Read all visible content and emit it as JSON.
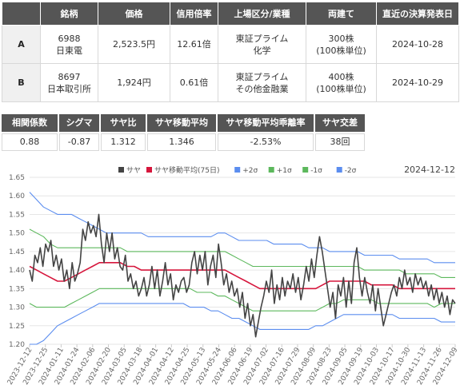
{
  "table": {
    "headers": [
      "",
      "銘柄",
      "価格",
      "信用倍率",
      "上場区分/業種",
      "両建て",
      "直近の決算発表日"
    ],
    "rows": [
      {
        "label": "A",
        "code": "6988",
        "name": "日東電",
        "price": "2,523.5円",
        "ratio": "12.61倍",
        "market": "東証プライム",
        "sector": "化学",
        "shares": "300株",
        "unit": "(100株単位)",
        "date": "2024-10-28"
      },
      {
        "label": "B",
        "code": "8697",
        "name": "日本取引所",
        "price": "1,924円",
        "ratio": "0.61倍",
        "market": "東証プライム",
        "sector": "その他金融業",
        "shares": "400株",
        "unit": "(100株単位)",
        "date": "2024-10-29"
      }
    ]
  },
  "stats": [
    {
      "label": "相関係数",
      "value": "0.88"
    },
    {
      "label": "シグマ",
      "value": "-0.87"
    },
    {
      "label": "サヤ比",
      "value": "1.312"
    },
    {
      "label": "サヤ移動平均",
      "value": "1.346"
    },
    {
      "label": "サヤ移動平均乖離率",
      "value": "-2.53%"
    },
    {
      "label": "サヤ交差",
      "value": "38回"
    }
  ],
  "chart_data": {
    "type": "line",
    "date_label": "2024-12-12",
    "legend": [
      "サヤ",
      "サヤ移動平均(75日)",
      "+2σ",
      "+1σ",
      "-1σ",
      "-2σ"
    ],
    "colors": {
      "saya": "#444444",
      "ma": "#d6163c",
      "p2": "#5b8def",
      "p1": "#5cb85c",
      "m1": "#5cb85c",
      "m2": "#5b8def"
    },
    "ylim": [
      1.2,
      1.65
    ],
    "yticks": [
      1.2,
      1.25,
      1.3,
      1.35,
      1.4,
      1.45,
      1.5,
      1.55,
      1.6,
      1.65
    ],
    "xticks": [
      "2023-12-12",
      "2023-12-25",
      "2024-01-11",
      "2024-01-24",
      "2024-02-06",
      "2024-02-20",
      "2024-03-05",
      "2024-03-18",
      "2024-04-01",
      "2024-04-12",
      "2024-04-25",
      "2024-05-13",
      "2024-05-24",
      "2024-06-06",
      "2024-06-19",
      "2024-07-02",
      "2024-07-16",
      "2024-07-29",
      "2024-08-09",
      "2024-08-23",
      "2024-09-05",
      "2024-09-19",
      "2024-10-03",
      "2024-10-17",
      "2024-10-30",
      "2024-11-13",
      "2024-11-26",
      "2024-12-09"
    ],
    "series": [
      {
        "name": "サヤ",
        "values": [
          1.4,
          1.37,
          1.44,
          1.42,
          1.46,
          1.41,
          1.47,
          1.45,
          1.48,
          1.41,
          1.44,
          1.4,
          1.43,
          1.37,
          1.4,
          1.35,
          1.42,
          1.37,
          1.39,
          1.42,
          1.51,
          1.48,
          1.53,
          1.5,
          1.52,
          1.49,
          1.55,
          1.47,
          1.42,
          1.5,
          1.45,
          1.5,
          1.43,
          1.46,
          1.41,
          1.4,
          1.44,
          1.37,
          1.39,
          1.35,
          1.37,
          1.33,
          1.35,
          1.38,
          1.33,
          1.36,
          1.41,
          1.35,
          1.4,
          1.33,
          1.37,
          1.42,
          1.36,
          1.39,
          1.32,
          1.36,
          1.34,
          1.37,
          1.38,
          1.34,
          1.36,
          1.42,
          1.45,
          1.39,
          1.44,
          1.4,
          1.45,
          1.36,
          1.41,
          1.44,
          1.38,
          1.47,
          1.42,
          1.36,
          1.39,
          1.34,
          1.37,
          1.33,
          1.35,
          1.3,
          1.34,
          1.27,
          1.31,
          1.25,
          1.28,
          1.22,
          1.26,
          1.3,
          1.33,
          1.37,
          1.34,
          1.4,
          1.31,
          1.36,
          1.32,
          1.38,
          1.33,
          1.37,
          1.35,
          1.39,
          1.34,
          1.38,
          1.32,
          1.36,
          1.41,
          1.37,
          1.43,
          1.38,
          1.44,
          1.49,
          1.45,
          1.4,
          1.35,
          1.3,
          1.34,
          1.27,
          1.36,
          1.33,
          1.38,
          1.3,
          1.37,
          1.31,
          1.42,
          1.46,
          1.38,
          1.33,
          1.38,
          1.34,
          1.31,
          1.36,
          1.29,
          1.35,
          1.3,
          1.25,
          1.28,
          1.31,
          1.34,
          1.36,
          1.33,
          1.38,
          1.35,
          1.4,
          1.36,
          1.38,
          1.34,
          1.39,
          1.36,
          1.38,
          1.35,
          1.37,
          1.33,
          1.36,
          1.32,
          1.35,
          1.31,
          1.34,
          1.3,
          1.33,
          1.28,
          1.32,
          1.31
        ]
      },
      {
        "name": "サヤ移動平均(75日)",
        "values": [
          1.41,
          1.4,
          1.39,
          1.38,
          1.37,
          1.37,
          1.38,
          1.39,
          1.4,
          1.41,
          1.42,
          1.42,
          1.42,
          1.42,
          1.41,
          1.41,
          1.4,
          1.4,
          1.4,
          1.4,
          1.4,
          1.4,
          1.4,
          1.4,
          1.4,
          1.4,
          1.4,
          1.4,
          1.4,
          1.39,
          1.38,
          1.37,
          1.36,
          1.35,
          1.35,
          1.35,
          1.35,
          1.35,
          1.35,
          1.35,
          1.35,
          1.35,
          1.36,
          1.37,
          1.37,
          1.37,
          1.37,
          1.37,
          1.37,
          1.36,
          1.36,
          1.36,
          1.36,
          1.35,
          1.35,
          1.35,
          1.35,
          1.35,
          1.35,
          1.35,
          1.35,
          1.35
        ]
      },
      {
        "name": "+2σ",
        "values": [
          1.61,
          1.59,
          1.57,
          1.56,
          1.55,
          1.55,
          1.55,
          1.54,
          1.53,
          1.52,
          1.51,
          1.5,
          1.5,
          1.5,
          1.5,
          1.5,
          1.5,
          1.49,
          1.49,
          1.49,
          1.49,
          1.49,
          1.49,
          1.49,
          1.49,
          1.49,
          1.49,
          1.5,
          1.5,
          1.49,
          1.48,
          1.48,
          1.48,
          1.48,
          1.48,
          1.47,
          1.47,
          1.47,
          1.47,
          1.47,
          1.46,
          1.46,
          1.46,
          1.45,
          1.45,
          1.45,
          1.45,
          1.45,
          1.44,
          1.44,
          1.44,
          1.44,
          1.44,
          1.43,
          1.43,
          1.43,
          1.43,
          1.43,
          1.42,
          1.42,
          1.42,
          1.42
        ]
      },
      {
        "name": "+1σ",
        "values": [
          1.51,
          1.5,
          1.49,
          1.47,
          1.46,
          1.46,
          1.46,
          1.46,
          1.46,
          1.46,
          1.46,
          1.46,
          1.46,
          1.46,
          1.45,
          1.45,
          1.45,
          1.45,
          1.45,
          1.45,
          1.45,
          1.45,
          1.45,
          1.45,
          1.45,
          1.45,
          1.45,
          1.45,
          1.45,
          1.44,
          1.43,
          1.42,
          1.41,
          1.41,
          1.41,
          1.41,
          1.41,
          1.41,
          1.41,
          1.41,
          1.41,
          1.41,
          1.41,
          1.41,
          1.41,
          1.41,
          1.41,
          1.41,
          1.4,
          1.4,
          1.4,
          1.4,
          1.4,
          1.4,
          1.39,
          1.39,
          1.39,
          1.39,
          1.39,
          1.38,
          1.38,
          1.38
        ]
      },
      {
        "name": "-1σ",
        "values": [
          1.31,
          1.3,
          1.3,
          1.3,
          1.3,
          1.3,
          1.31,
          1.32,
          1.33,
          1.34,
          1.35,
          1.35,
          1.35,
          1.35,
          1.35,
          1.35,
          1.35,
          1.35,
          1.35,
          1.35,
          1.35,
          1.35,
          1.35,
          1.35,
          1.34,
          1.34,
          1.34,
          1.33,
          1.33,
          1.32,
          1.31,
          1.3,
          1.29,
          1.29,
          1.29,
          1.29,
          1.29,
          1.29,
          1.29,
          1.29,
          1.29,
          1.29,
          1.3,
          1.31,
          1.31,
          1.32,
          1.32,
          1.32,
          1.32,
          1.32,
          1.31,
          1.31,
          1.31,
          1.31,
          1.31,
          1.31,
          1.31,
          1.31,
          1.3,
          1.31,
          1.31,
          1.31
        ]
      },
      {
        "name": "-2σ",
        "values": [
          1.2,
          1.2,
          1.21,
          1.23,
          1.25,
          1.26,
          1.27,
          1.28,
          1.29,
          1.3,
          1.31,
          1.31,
          1.31,
          1.31,
          1.31,
          1.31,
          1.31,
          1.31,
          1.31,
          1.31,
          1.31,
          1.31,
          1.31,
          1.3,
          1.3,
          1.3,
          1.29,
          1.29,
          1.28,
          1.27,
          1.27,
          1.26,
          1.25,
          1.24,
          1.24,
          1.24,
          1.24,
          1.24,
          1.24,
          1.24,
          1.24,
          1.25,
          1.25,
          1.26,
          1.27,
          1.28,
          1.28,
          1.28,
          1.28,
          1.28,
          1.28,
          1.28,
          1.28,
          1.27,
          1.27,
          1.27,
          1.27,
          1.27,
          1.27,
          1.26,
          1.26,
          1.26
        ]
      }
    ]
  }
}
